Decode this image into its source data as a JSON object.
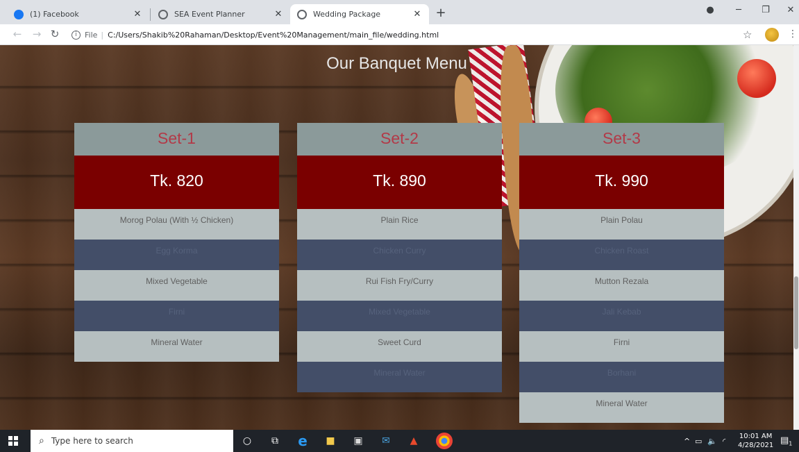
{
  "browser": {
    "tabs": [
      {
        "title": "(1) Facebook",
        "icon": "facebook-icon",
        "active": false
      },
      {
        "title": "SEA Event Planner",
        "icon": "globe-icon",
        "active": false
      },
      {
        "title": "Wedding Package",
        "icon": "globe-icon",
        "active": true
      }
    ],
    "new_tab": "+",
    "address": {
      "scheme_label": "File",
      "url": "C:/Users/Shakib%20Rahaman/Desktop/Event%20Management/main_file/wedding.html"
    }
  },
  "page": {
    "heading": "Our Banquet Menu",
    "sets": [
      {
        "name": "Set-1",
        "price": "Tk. 820",
        "items": [
          "Morog Polau (With ½ Chicken)",
          "Egg Korma",
          "Mixed Vegetable",
          "Firni",
          "Mineral Water"
        ]
      },
      {
        "name": "Set-2",
        "price": "Tk. 890",
        "items": [
          "Plain Rice",
          "Chicken Curry",
          "Rui Fish Fry/Curry",
          "Mixed Vegetable",
          "Sweet Curd",
          "Mineral Water"
        ]
      },
      {
        "name": "Set-3",
        "price": "Tk. 990",
        "items": [
          "Plain Polau",
          "Chicken Roast",
          "Mutton Rezala",
          "Jali Kebab",
          "Firni",
          "Borhani",
          "Mineral Water"
        ]
      }
    ]
  },
  "taskbar": {
    "search_placeholder": "Type here to search",
    "time": "10:01 AM",
    "date": "4/28/2021",
    "notification_count": "1"
  },
  "colors": {
    "set_header_bg": "#8b9a9a",
    "set_title": "#b23a48",
    "price_bg": "#7a0000",
    "item_light": "#b6bfc0",
    "item_dark": "#434e68"
  }
}
